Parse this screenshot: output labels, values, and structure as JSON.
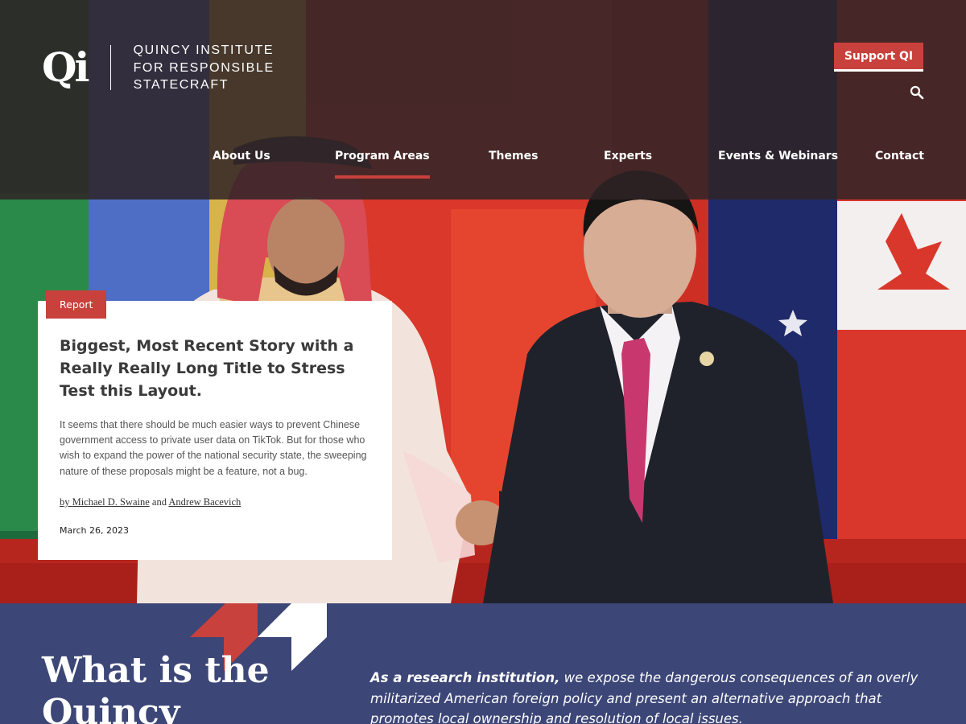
{
  "header": {
    "logo_mark": "Qi",
    "logo_lines": [
      "QUINCY INSTITUTE",
      "FOR RESPONSIBLE",
      "STATECRAFT"
    ],
    "support_label": "Support QI",
    "search_icon": "search-icon"
  },
  "nav": {
    "items": [
      {
        "label": "About Us",
        "active": false
      },
      {
        "label": "Program Areas",
        "active": true
      },
      {
        "label": "Themes",
        "active": false
      },
      {
        "label": "Experts",
        "active": false
      },
      {
        "label": "Events & Webinars",
        "active": false
      },
      {
        "label": "Contact",
        "active": false
      }
    ]
  },
  "feature": {
    "badge": "Report",
    "title": "Biggest, Most Recent Story with a Really Really Long Title to Stress Test this Layout.",
    "excerpt": "It seems that there should be much easier ways to prevent Chinese government access to private user data on TikTok. But for those who wish to expand the power of the national security state, the sweeping nature of these proposals might be a feature, not a bug.",
    "byline_prefix": "by",
    "author_1": "Michael D. Swaine",
    "byline_joiner": "and",
    "author_2": "Andrew Bacevich",
    "date": "March 26, 2023"
  },
  "about": {
    "heading": "What is the Quincy",
    "intro_bold": "As a research institution,",
    "intro_rest": " we expose the dangerous consequences of an overly militarized American foreign policy and present an alternative approach that promotes local ownership and resolution of local issues."
  },
  "colors": {
    "accent": "#c8413c",
    "header_overlay": "#2e2426",
    "section_blue": "#3c4677"
  }
}
